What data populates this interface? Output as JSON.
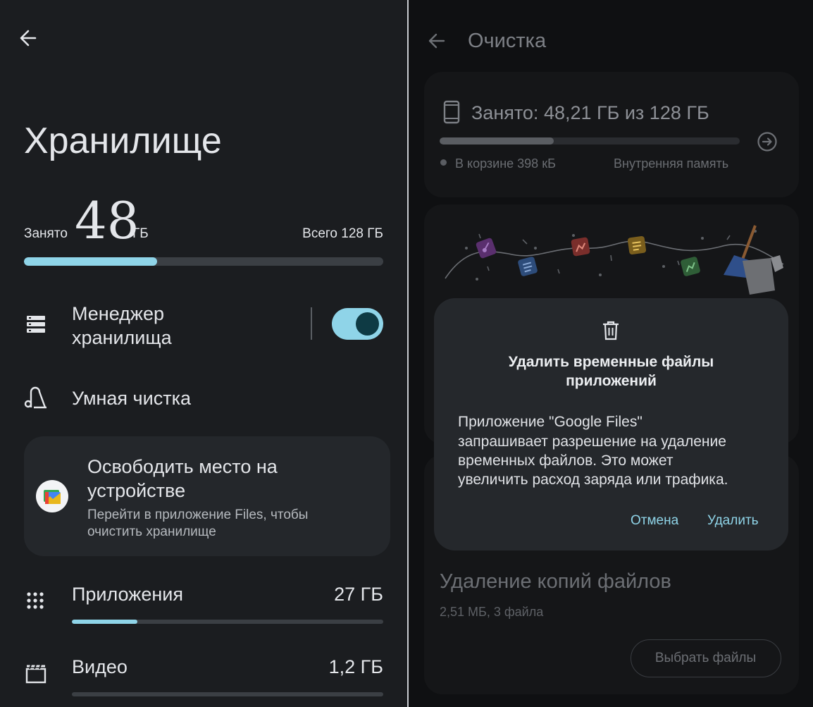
{
  "left": {
    "title": "Хранилище",
    "used_label": "Занято",
    "used_value": "48",
    "used_unit": "ГБ",
    "total_label": "Всего 128 ГБ",
    "used_fraction": 0.37,
    "storage_manager": {
      "label_line1": "Менеджер",
      "label_line2": "хранилища",
      "enabled": true
    },
    "smart_clean_label": "Умная чистка",
    "free_space_card": {
      "title_line1": "Освободить место на",
      "title_line2": "устройстве",
      "subtitle_line1": "Перейти в приложение Files, чтобы",
      "subtitle_line2": "очистить хранилище"
    },
    "categories": [
      {
        "label": "Приложения",
        "size": "27 ГБ",
        "fraction": 0.21,
        "icon": "apps-grid-icon"
      },
      {
        "label": "Видео",
        "size": "1,2 ГБ",
        "fraction": 0.0,
        "icon": "video-icon"
      }
    ]
  },
  "right": {
    "title": "Очистка",
    "storage_card": {
      "used_text": "Занято: 48,21 ГБ из 128 ГБ",
      "used_fraction": 0.38,
      "trash_text": "В корзине 398 кБ",
      "memory_label": "Внутренняя память"
    },
    "duplicates_card": {
      "title": "Удаление копий файлов",
      "subtitle": "2,51 МБ, 3 файла",
      "button_label": "Выбрать файлы"
    }
  },
  "dialog": {
    "title_line1": "Удалить временные файлы",
    "title_line2": "приложений",
    "body_lines": [
      "Приложение \"Google Files\"",
      "запрашивает разрешение на удаление",
      "временных файлов. Это может",
      "увеличить расход заряда или трафика."
    ],
    "cancel_label": "Отмена",
    "delete_label": "Удалить"
  },
  "colors": {
    "accent": "#8fd4e8",
    "left_bg": "#1b1d20",
    "right_bg": "#0f1012",
    "dialog_bg": "#25282c"
  }
}
